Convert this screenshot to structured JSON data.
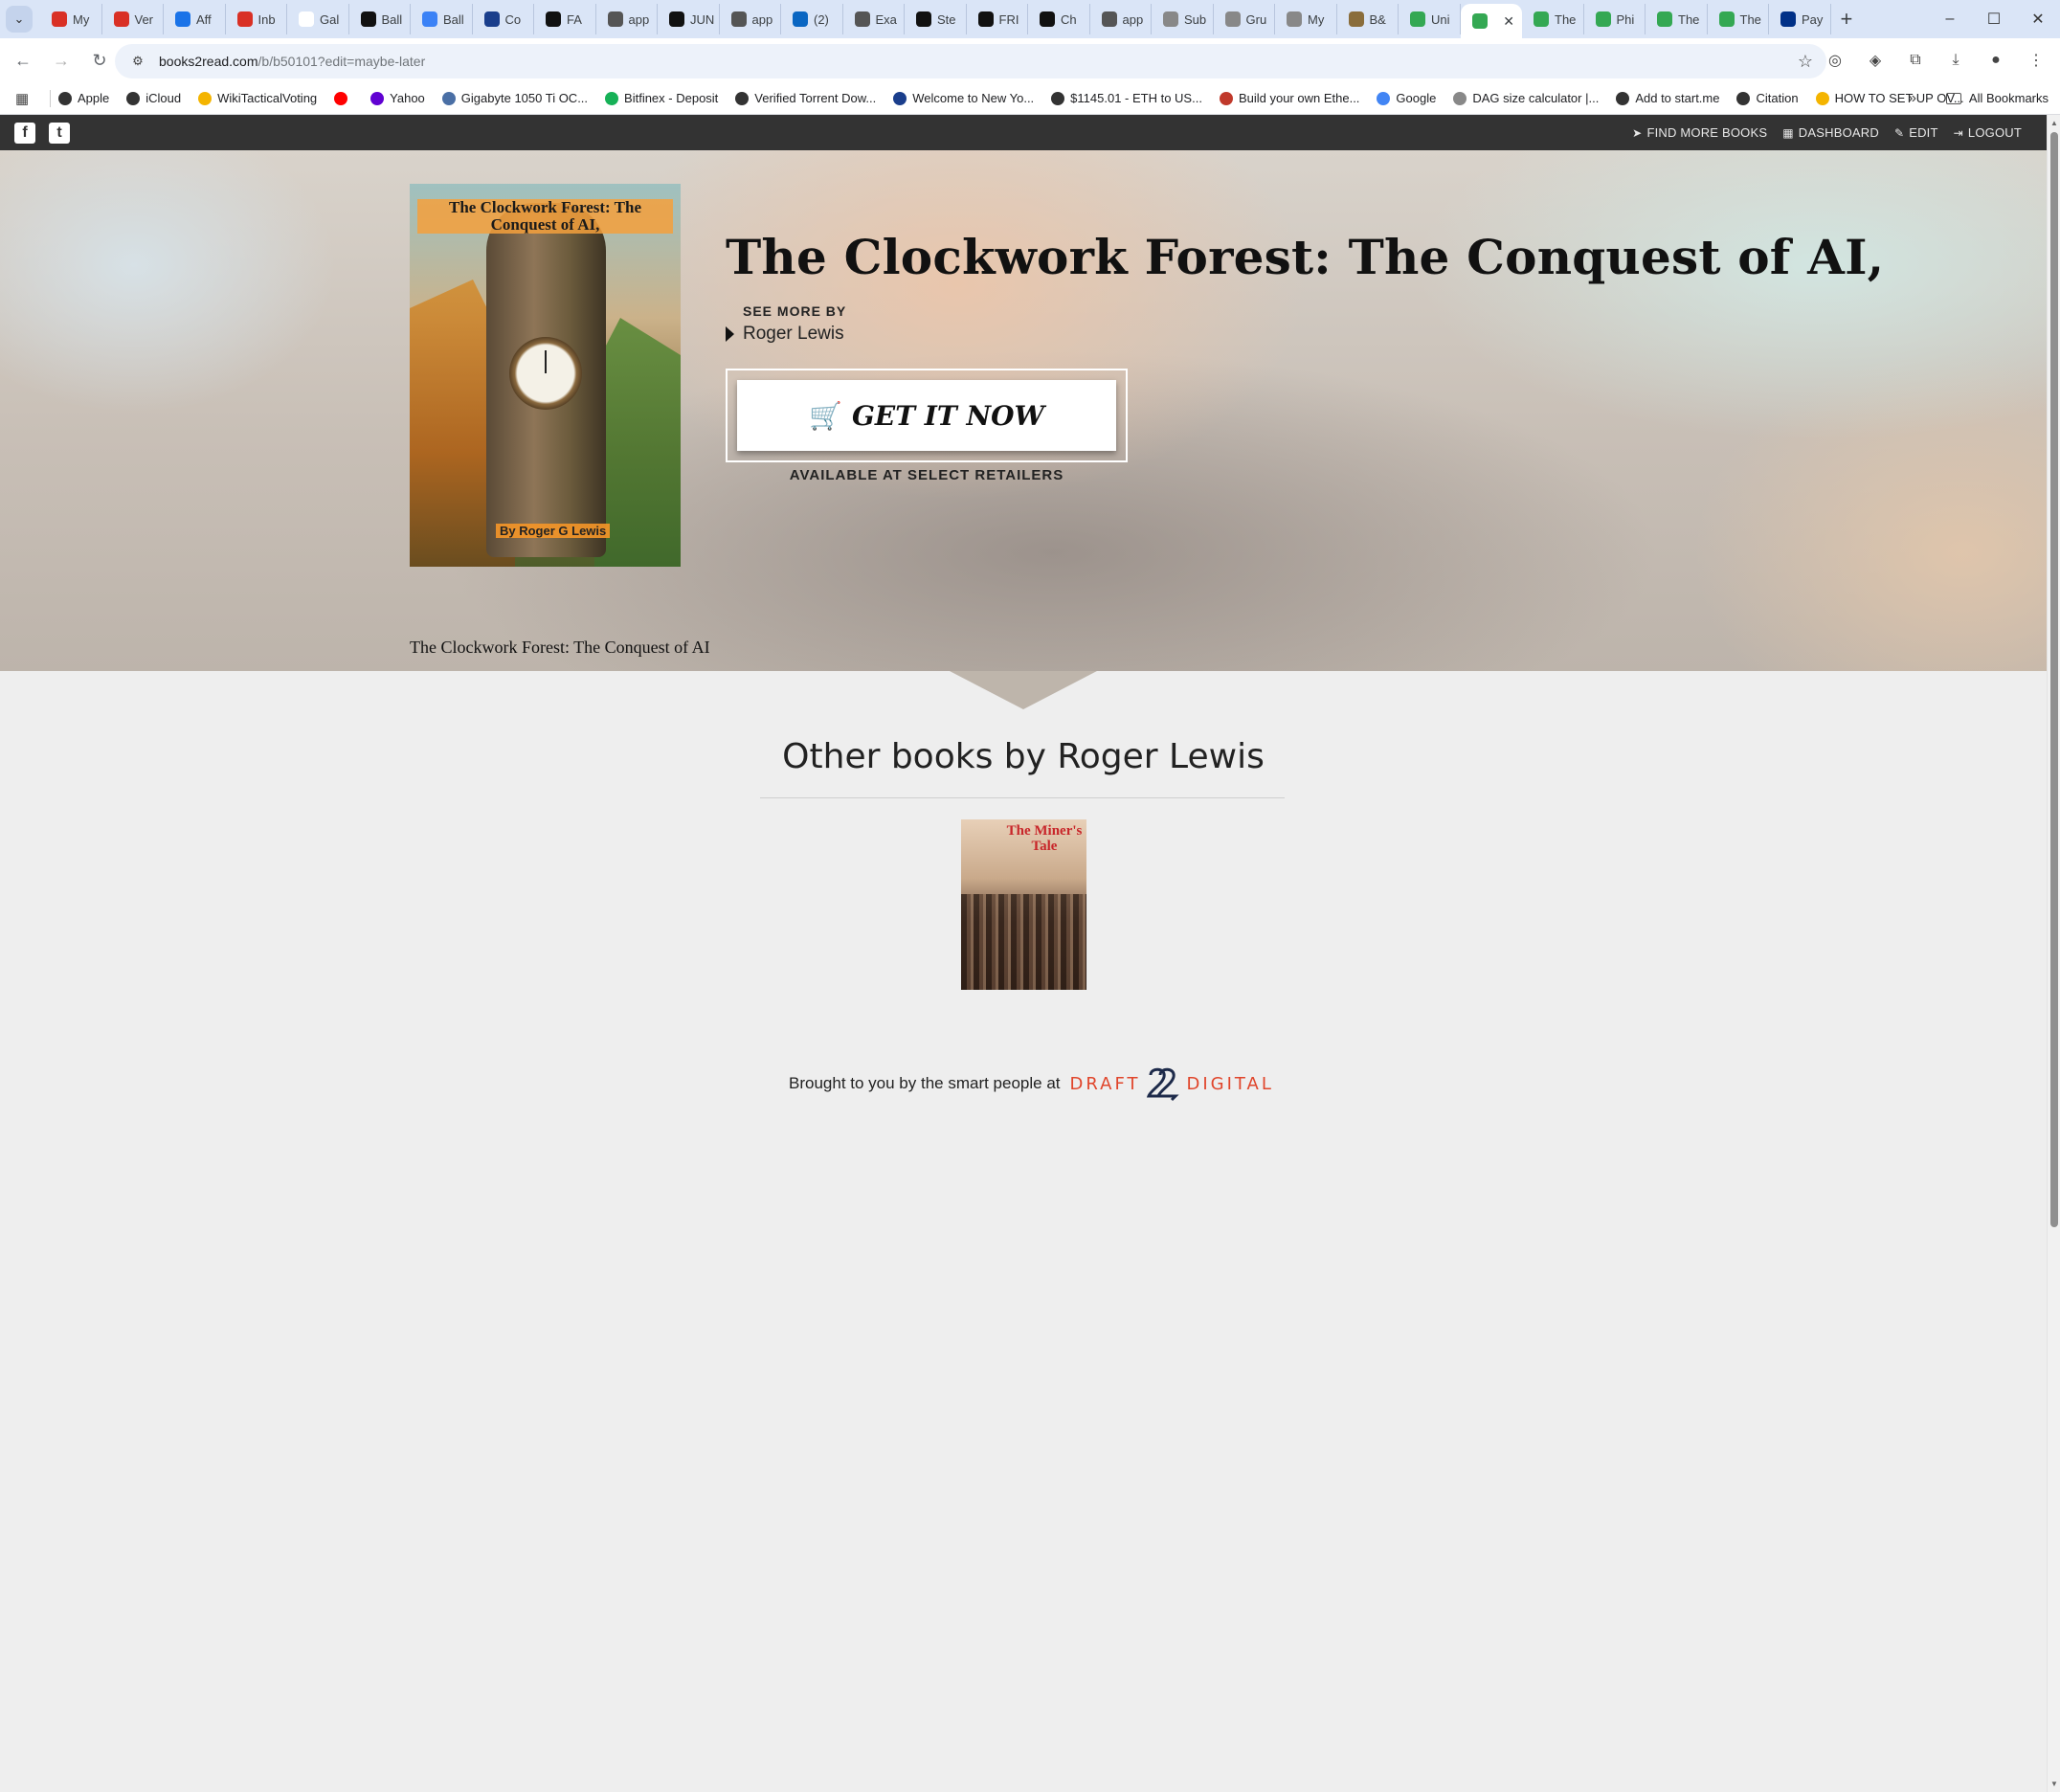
{
  "browser": {
    "tabs": [
      {
        "label": "My",
        "color": "#d93025"
      },
      {
        "label": "Ver",
        "color": "#d93025"
      },
      {
        "label": "Aff",
        "color": "#1a73e8"
      },
      {
        "label": "Inb",
        "color": "#d93025"
      },
      {
        "label": "Gal",
        "color": "#ffffff"
      },
      {
        "label": "Ball",
        "color": "#111111"
      },
      {
        "label": "Ball",
        "color": "#3b82f6"
      },
      {
        "label": "Co",
        "color": "#1a3e8c"
      },
      {
        "label": "FA",
        "color": "#111111"
      },
      {
        "label": "app",
        "color": "#555555"
      },
      {
        "label": "JUN",
        "color": "#111111"
      },
      {
        "label": "app",
        "color": "#555555"
      },
      {
        "label": "(2)",
        "color": "#0a66c2"
      },
      {
        "label": "Exa",
        "color": "#555555"
      },
      {
        "label": "Ste",
        "color": "#111111"
      },
      {
        "label": "FRI",
        "color": "#111111"
      },
      {
        "label": "Ch",
        "color": "#111111"
      },
      {
        "label": "app",
        "color": "#555555"
      },
      {
        "label": "Sub",
        "color": "#888888"
      },
      {
        "label": "Gru",
        "color": "#888888"
      },
      {
        "label": "My",
        "color": "#888888"
      },
      {
        "label": "B&",
        "color": "#8a6d3b"
      },
      {
        "label": "Uni",
        "color": "#34a853"
      },
      {
        "label": "",
        "color": "#34a853",
        "active": true
      },
      {
        "label": "The",
        "color": "#34a853"
      },
      {
        "label": "Phi",
        "color": "#34a853"
      },
      {
        "label": "The",
        "color": "#34a853"
      },
      {
        "label": "The",
        "color": "#34a853"
      },
      {
        "label": "Pay",
        "color": "#003087"
      }
    ],
    "new_tab": "+",
    "url_host": "books2read.com",
    "url_path": "/b/b50101?edit=maybe-later",
    "bookmarks": [
      {
        "label": "Apple",
        "color": "#333333"
      },
      {
        "label": "iCloud",
        "color": "#333333"
      },
      {
        "label": "WikiTacticalVoting",
        "color": "#f4b400"
      },
      {
        "label": "",
        "color": "#ff0000"
      },
      {
        "label": "Yahoo",
        "color": "#6001d2"
      },
      {
        "label": "Gigabyte 1050 Ti OC...",
        "color": "#4a6fa5"
      },
      {
        "label": "Bitfinex - Deposit",
        "color": "#16b157"
      },
      {
        "label": "Verified Torrent Dow...",
        "color": "#333333"
      },
      {
        "label": "Welcome to New Yo...",
        "color": "#1a3e8c"
      },
      {
        "label": "$1145.01 - ETH to US...",
        "color": "#333333"
      },
      {
        "label": "Build your own Ethe...",
        "color": "#c0392b"
      },
      {
        "label": "Google",
        "color": "#4285f4"
      },
      {
        "label": "DAG size calculator |...",
        "color": "#888888"
      },
      {
        "label": "Add to start.me",
        "color": "#333333"
      },
      {
        "label": "Citation",
        "color": "#333333"
      },
      {
        "label": "HOW TO SET UP OV...",
        "color": "#f4b400"
      }
    ],
    "all_bookmarks": "All Bookmarks"
  },
  "site": {
    "nav": {
      "find_more_books": "FIND MORE BOOKS",
      "dashboard": "DASHBOARD",
      "edit": "EDIT",
      "logout": "LOGOUT"
    }
  },
  "book": {
    "title": "The Clockwork Forest: The Conquest of AI,",
    "see_more_by": "SEE MORE BY",
    "author": "Roger Lewis",
    "cta": "GET IT NOW",
    "available": "AVAILABLE AT SELECT RETAILERS",
    "caption": "The Clockwork Forest: The Conquest of AI",
    "cover_title": "The Clockwork Forest: The Conquest of AI,",
    "cover_author": "By Roger G Lewis"
  },
  "other_books": {
    "heading": "Other books by Roger Lewis",
    "items": [
      {
        "cover_title": "The Miner's Tale"
      }
    ]
  },
  "footer": {
    "text": "Brought to you by the smart people at",
    "brand_left": "DRAFT",
    "brand_right": "DIGITAL"
  }
}
